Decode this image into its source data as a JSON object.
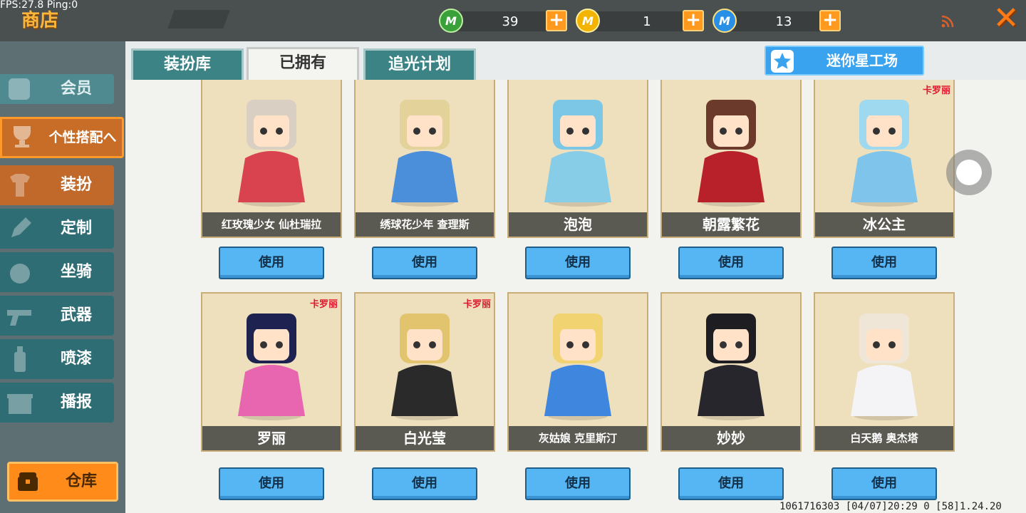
{
  "debug": {
    "fps_text": "FPS:27.8  Ping:0"
  },
  "header": {
    "title": "商店"
  },
  "currencies": [
    {
      "icon": "green-gem-icon",
      "letter": "M",
      "color": "#3aa13a",
      "value": "39"
    },
    {
      "icon": "gold-coin-icon",
      "letter": "M",
      "color": "#f2b400",
      "value": "1"
    },
    {
      "icon": "blue-coin-icon",
      "letter": "M",
      "color": "#2a8fe6",
      "value": "13"
    }
  ],
  "plus_label": "+",
  "close_label": "✕",
  "sidebar": {
    "member": "会员",
    "group": "个性搭配へ",
    "items": [
      "装扮",
      "定制",
      "坐骑",
      "武器",
      "喷漆",
      "播报"
    ],
    "warehouse": "仓库"
  },
  "tabs": [
    "装扮库",
    "已拥有",
    "追光计划"
  ],
  "studio_button": "迷你星工场",
  "use_label": "使用",
  "cards": [
    {
      "name": "红玫瑰少女 仙杜瑞拉",
      "hair": "#d9cfc2",
      "outfit": "#d9434f",
      "badge": ""
    },
    {
      "name": "绣球花少年 查理斯",
      "hair": "#e3d39a",
      "outfit": "#4b8fdb",
      "badge": ""
    },
    {
      "name": "泡泡",
      "hair": "#7cc7e6",
      "outfit": "#88cde8",
      "badge": ""
    },
    {
      "name": "朝露繁花",
      "hair": "#6b3a2a",
      "outfit": "#b8202a",
      "badge": ""
    },
    {
      "name": "冰公主",
      "hair": "#9fd9ef",
      "outfit": "#7fc4ea",
      "badge": "卡罗丽"
    },
    {
      "name": "罗丽",
      "hair": "#1e2250",
      "outfit": "#e865b0",
      "badge": "卡罗丽"
    },
    {
      "name": "白光莹",
      "hair": "#e2c46e",
      "outfit": "#2a2a2a",
      "badge": "卡罗丽"
    },
    {
      "name": "灰姑娘 克里斯汀",
      "hair": "#f1d471",
      "outfit": "#3f86de",
      "badge": ""
    },
    {
      "name": "妙妙",
      "hair": "#1d1d22",
      "outfit": "#26262c",
      "badge": ""
    },
    {
      "name": "白天鹅 奥杰塔",
      "hair": "#f0e6d8",
      "outfit": "#f4f4f6",
      "badge": ""
    }
  ],
  "footer": {
    "text": "1061716303    [04/07]20:29 0  [58]1.24.20"
  }
}
